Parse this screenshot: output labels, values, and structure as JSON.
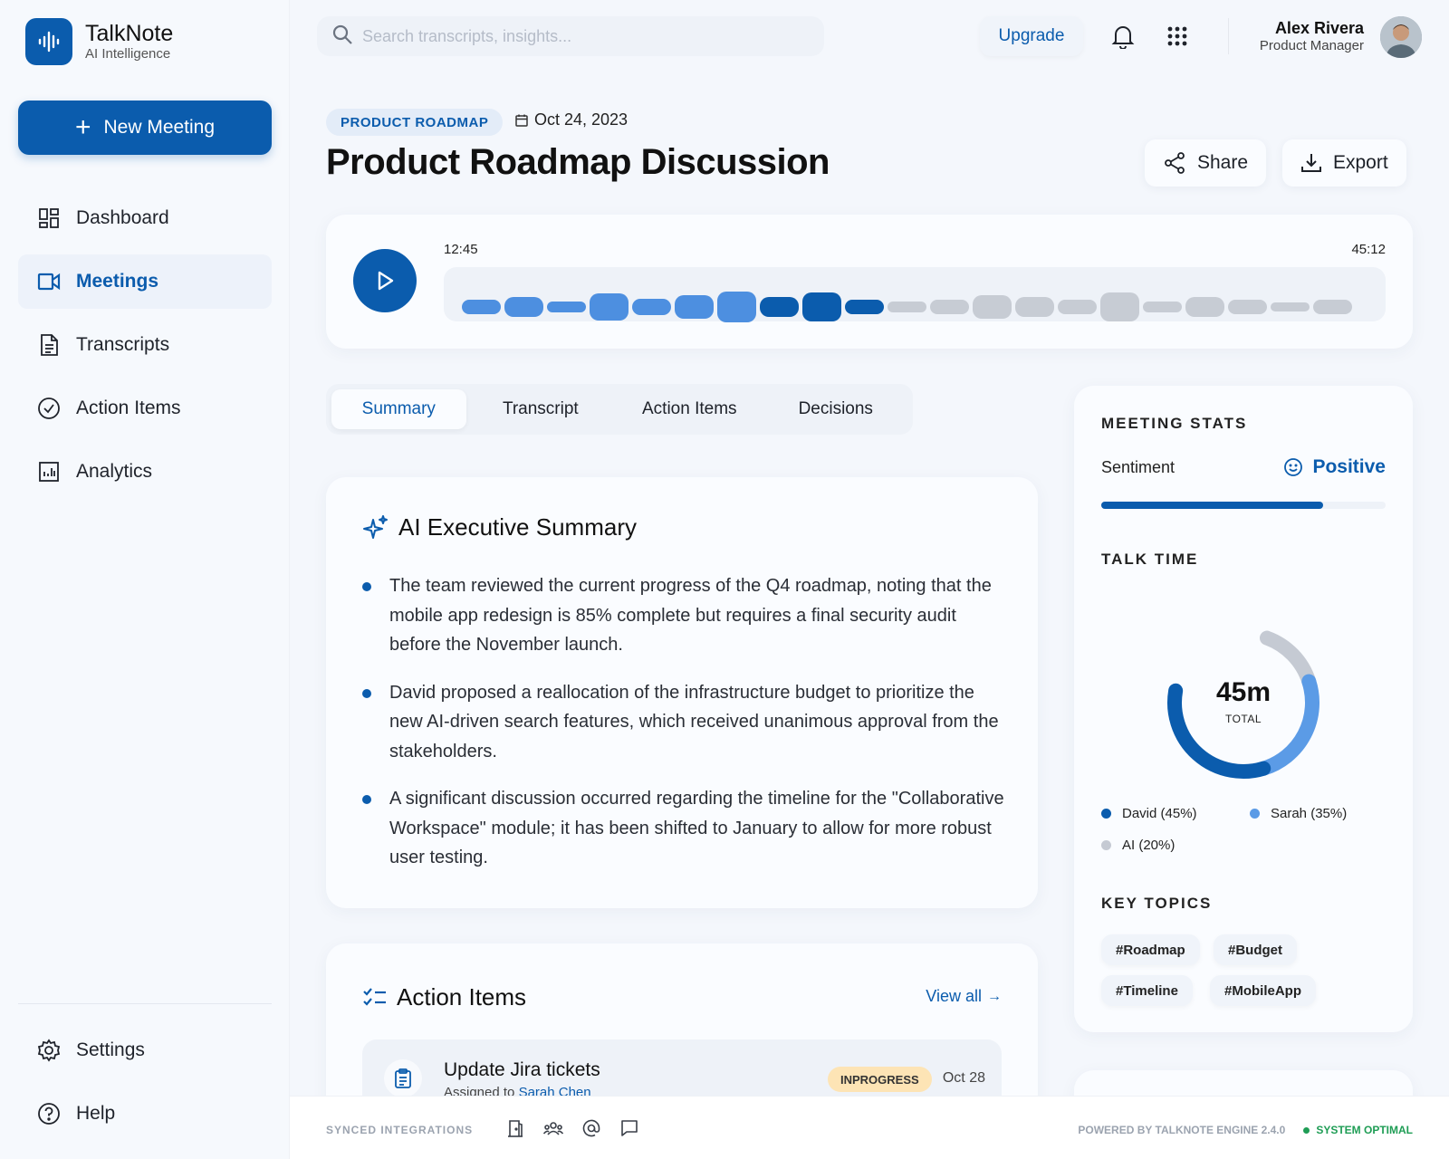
{
  "brand": {
    "name": "TalkNote",
    "subtitle": "AI Intelligence"
  },
  "sidebar": {
    "new_meeting_label": "New Meeting",
    "items": [
      {
        "label": "Dashboard",
        "icon": "dashboard-icon"
      },
      {
        "label": "Meetings",
        "icon": "video-icon",
        "active": true
      },
      {
        "label": "Transcripts",
        "icon": "document-icon"
      },
      {
        "label": "Action Items",
        "icon": "check-circle-icon"
      },
      {
        "label": "Analytics",
        "icon": "analytics-icon"
      }
    ],
    "bottom_items": [
      {
        "label": "Settings",
        "icon": "gear-icon"
      },
      {
        "label": "Help",
        "icon": "help-icon"
      }
    ]
  },
  "header": {
    "search_placeholder": "Search transcripts, insights...",
    "upgrade_label": "Upgrade",
    "user": {
      "name": "Alex Rivera",
      "role": "Product Manager"
    }
  },
  "meeting": {
    "tag": "PRODUCT ROADMAP",
    "date": "Oct 24, 2023",
    "title": "Product Roadmap Discussion",
    "share_label": "Share",
    "export_label": "Export"
  },
  "player": {
    "current_time": "12:45",
    "total_time": "45:12",
    "played_fraction": 0.47
  },
  "tabs": [
    "Summary",
    "Transcript",
    "Action Items",
    "Decisions"
  ],
  "summary": {
    "title": "AI Executive Summary",
    "bullets": [
      "The team reviewed the current progress of the Q4 roadmap, noting that the mobile app redesign is 85% complete but requires a final security audit before the November launch.",
      "David proposed a reallocation of the infrastructure budget to prioritize the new AI-driven search features, which received unanimous approval from the stakeholders.",
      "A significant discussion occurred regarding the timeline for the \"Collaborative Workspace\" module; it has been shifted to January to allow for more robust user testing."
    ]
  },
  "action_items": {
    "title": "Action Items",
    "view_all": "View all",
    "items": [
      {
        "title": "Update Jira tickets",
        "assigned_prefix": "Assigned to",
        "assignee": "Sarah Chen",
        "status": "INPROGRESS",
        "date": "Oct 28"
      }
    ]
  },
  "stats": {
    "title": "MEETING STATS",
    "sentiment_label": "Sentiment",
    "sentiment_value": "Positive",
    "sentiment_fraction": 0.78,
    "talk_time_title": "TALK TIME",
    "total_value": "45m",
    "total_label": "TOTAL",
    "talk_time": [
      {
        "name": "David",
        "label": "David (45%)",
        "percent": 45,
        "color": "#0b5cad"
      },
      {
        "name": "Sarah",
        "label": "Sarah (35%)",
        "percent": 35,
        "color": "#5b9be6"
      },
      {
        "name": "AI",
        "label": "AI (20%)",
        "percent": 20,
        "color": "#c5cad3"
      }
    ],
    "key_topics_title": "KEY TOPICS",
    "topics": [
      "#Roadmap",
      "#Budget",
      "#Timeline",
      "#MobileApp"
    ]
  },
  "footer": {
    "synced_label": "SYNCED INTEGRATIONS",
    "powered_by": "POWERED BY TALKNOTE ENGINE 2.4.0",
    "status": "SYSTEM OPTIMAL"
  },
  "colors": {
    "primary": "#0b5cad",
    "accent": "#5b9be6",
    "muted": "#c5cad3",
    "success": "#1f9d55",
    "badge": "#fde4b5"
  }
}
